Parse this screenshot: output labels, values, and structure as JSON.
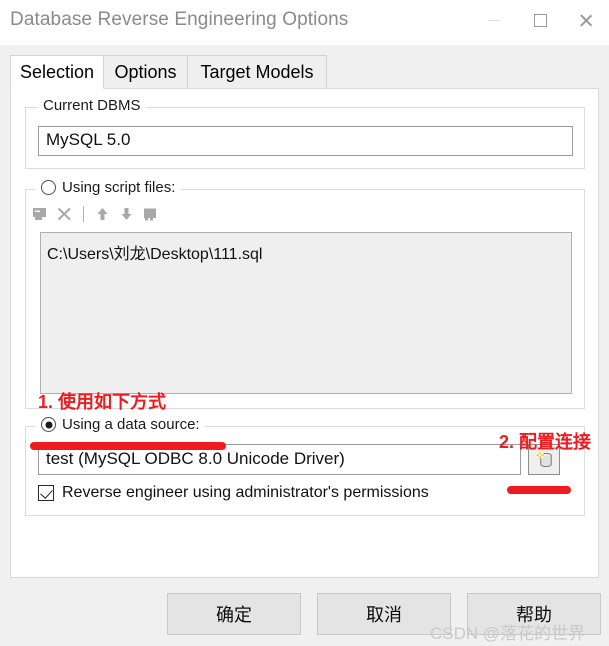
{
  "window": {
    "title": "Database Reverse Engineering Options",
    "controls": {
      "minimize": "minimize",
      "maximize": "maximize",
      "close": "close"
    }
  },
  "tabs": [
    {
      "label": "Selection",
      "active": true
    },
    {
      "label": "Options",
      "active": false
    },
    {
      "label": "Target Models",
      "active": false
    }
  ],
  "dbms": {
    "group_label": "Current DBMS",
    "value": "MySQL 5.0"
  },
  "script_files": {
    "radio_label": "Using script files:",
    "selected": false,
    "toolbar": [
      "add-file-icon",
      "delete-icon",
      "separator",
      "move-up-icon",
      "move-down-icon",
      "edit-file-icon"
    ],
    "items": [
      "C:\\Users\\刘龙\\Desktop\\111.sql"
    ]
  },
  "data_source": {
    "radio_label": "Using a data source:",
    "selected": true,
    "value": "test (MySQL ODBC 8.0 Unicode Driver)",
    "config_button_icon": "database-icon",
    "checkbox": {
      "label": "Reverse engineer using administrator's permissions",
      "checked": true
    }
  },
  "annotations": {
    "color": "#ee1c20",
    "note1": "1. 使用如下方式",
    "note2": "2. 配置连接"
  },
  "buttons": {
    "ok": "确定",
    "cancel": "取消",
    "help": "帮助"
  },
  "watermark": "CSDN @落花的世界"
}
